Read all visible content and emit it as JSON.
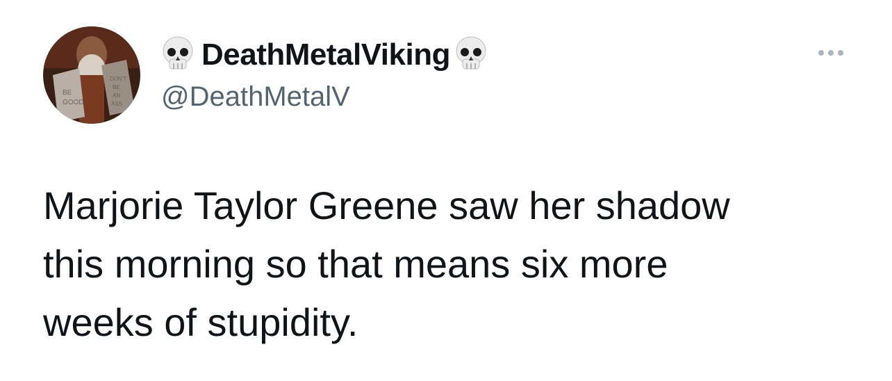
{
  "author": {
    "display_name": "DeathMetalViking",
    "handle": "@DeathMetalV",
    "name_prefix_icon": "skull-icon",
    "name_suffix_icon": "skull-icon",
    "avatar_icon": "avatar-moses-tablets"
  },
  "menu": {
    "icon": "more-options-icon"
  },
  "tweet": {
    "lines": [
      "Marjorie Taylor Greene saw her shadow",
      "this morning so that means six more",
      "weeks of stupidity."
    ]
  },
  "colors": {
    "text_primary": "#0f1419",
    "text_secondary": "#536471",
    "menu_dots": "#a9b4bd",
    "background": "#ffffff"
  }
}
